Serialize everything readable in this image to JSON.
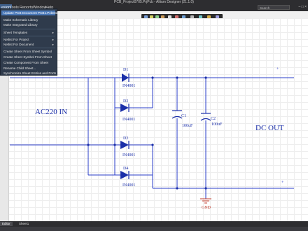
{
  "window": {
    "title": "PCB_Project0705.PrjPcb - Altium Designer (21.1.0)"
  },
  "menubar": {
    "items": [
      "esign",
      "Tools",
      "Reports",
      "Window",
      "Help"
    ]
  },
  "search": {
    "placeholder": "Search"
  },
  "menu": {
    "items": [
      {
        "label": "Update PCB Document PCB1.PcbDoc",
        "highlight": true,
        "submenu": false
      },
      {
        "label": "Make Schematic Library",
        "submenu": false
      },
      {
        "label": "Make Integrated Library",
        "submenu": false
      },
      {
        "label": "Sheet Templates",
        "submenu": true
      },
      {
        "label": "Netlist For Project",
        "submenu": true
      },
      {
        "label": "Netlist For Document",
        "submenu": true
      },
      {
        "label": "Create Sheet From Sheet Symbol",
        "submenu": false
      },
      {
        "label": "Create Sheet Symbol From Sheet",
        "submenu": false
      },
      {
        "label": "Create Component From Sheet",
        "submenu": false
      },
      {
        "label": "Rename Child Sheet...",
        "submenu": false
      },
      {
        "label": "Synchronize Sheet Entries and Ports",
        "submenu": false
      }
    ]
  },
  "schematic": {
    "input_label": "AC220 IN",
    "output_label": "DC OUT",
    "diodes": [
      {
        "ref": "D1",
        "value": "IN4001"
      },
      {
        "ref": "D2",
        "value": "IN4001"
      },
      {
        "ref": "D3",
        "value": "IN4001"
      },
      {
        "ref": "D4",
        "value": "IN4001"
      }
    ],
    "capacitors": [
      {
        "ref": "C1",
        "value": "100uF"
      },
      {
        "ref": "C2",
        "value": "100uF"
      }
    ],
    "ground_label": "GND",
    "wire_color": "#2a3cc8",
    "component_color": "#1b2fa8"
  },
  "status": {
    "tabs": [
      "Editor",
      "Sheet1"
    ]
  },
  "colors": {
    "menu_bg": "#2f3b4c",
    "menu_highlight": "#4a78b8",
    "titlebar_bg": "#2d2d30"
  }
}
